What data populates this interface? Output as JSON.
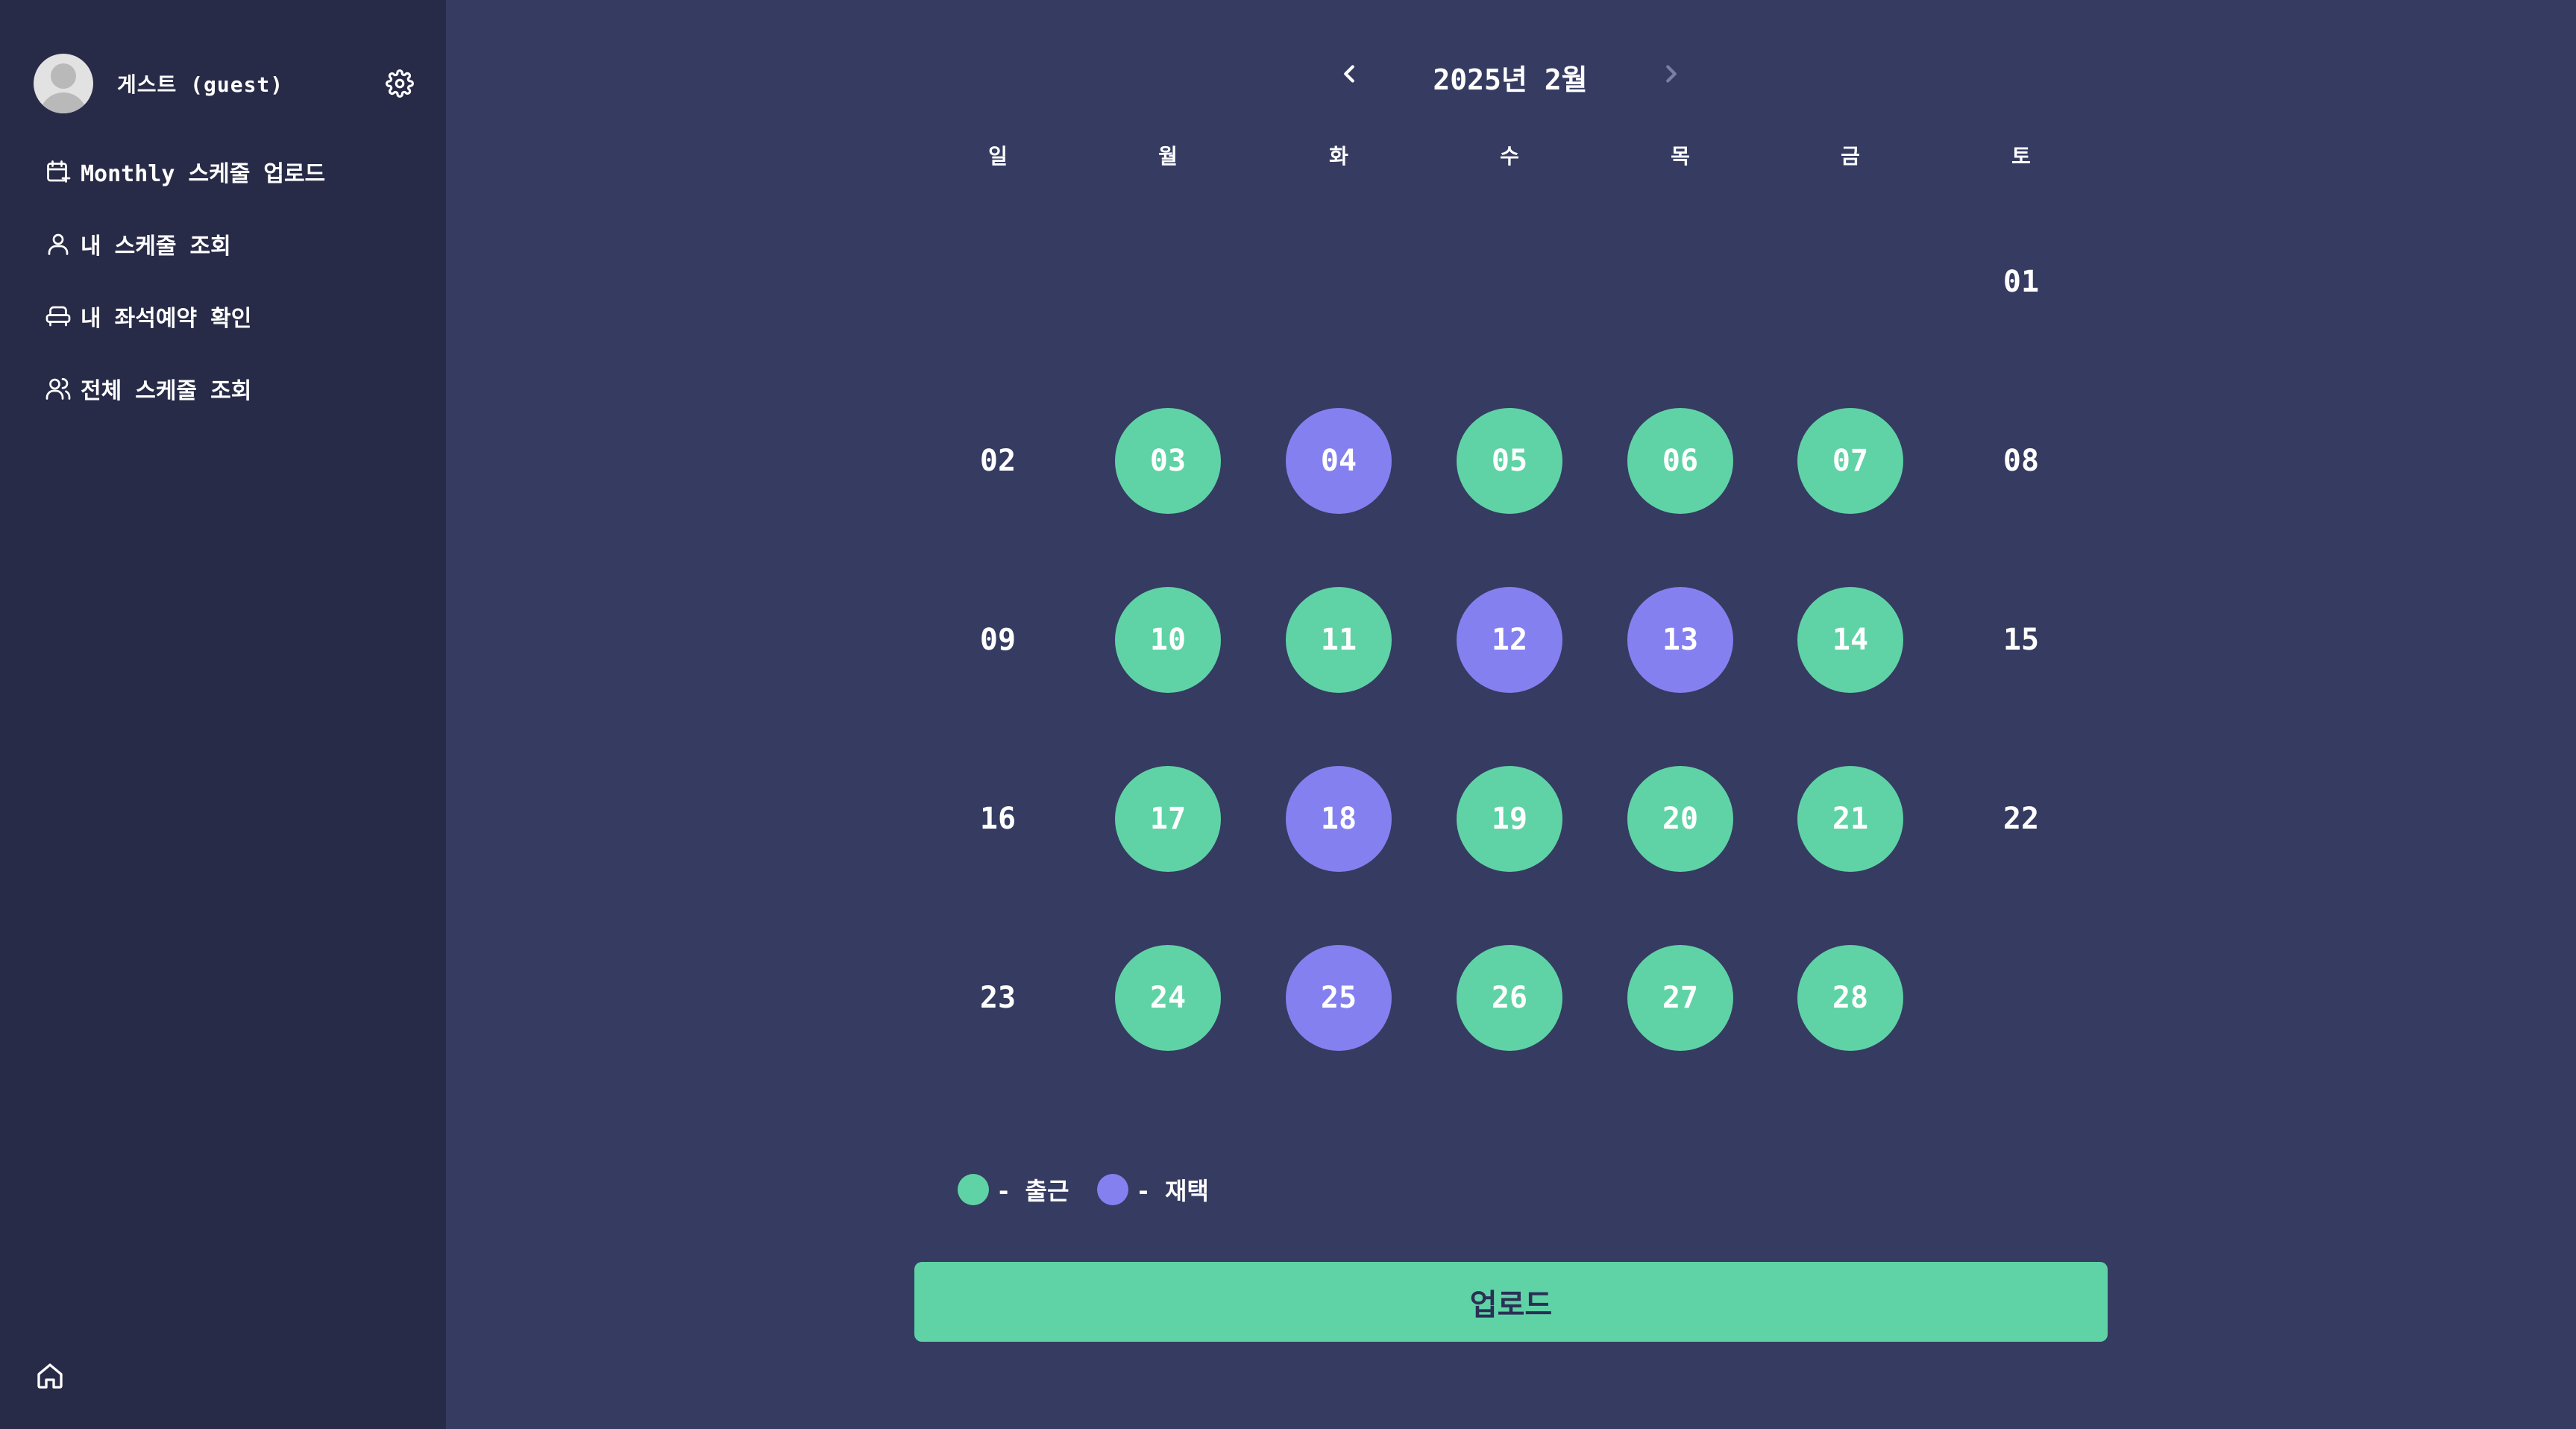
{
  "colors": {
    "background": "#363b61",
    "sidebar": "#282b47",
    "office": "#5fd3a6",
    "remote": "#8580f0",
    "text": "#ffffff"
  },
  "profile": {
    "name": "게스트 (guest)",
    "avatar_icon": "user-avatar-icon",
    "settings_icon": "gear-icon"
  },
  "sidebar": {
    "items": [
      {
        "label": "Monthly 스케줄 업로드",
        "icon": "calendar-plus-icon"
      },
      {
        "label": "내 스케줄 조회",
        "icon": "user-icon"
      },
      {
        "label": "내 좌석예약 확인",
        "icon": "seat-icon"
      },
      {
        "label": "전체 스케줄 조회",
        "icon": "users-icon"
      }
    ],
    "home_icon": "home-icon"
  },
  "calendar": {
    "title": "2025년 2월",
    "weekdays": [
      "일",
      "월",
      "화",
      "수",
      "목",
      "금",
      "토"
    ],
    "days": [
      {
        "label": "01",
        "status": "none"
      },
      {
        "label": "02",
        "status": "none"
      },
      {
        "label": "03",
        "status": "office"
      },
      {
        "label": "04",
        "status": "remote"
      },
      {
        "label": "05",
        "status": "office"
      },
      {
        "label": "06",
        "status": "office"
      },
      {
        "label": "07",
        "status": "office"
      },
      {
        "label": "08",
        "status": "none"
      },
      {
        "label": "09",
        "status": "none"
      },
      {
        "label": "10",
        "status": "office"
      },
      {
        "label": "11",
        "status": "office"
      },
      {
        "label": "12",
        "status": "remote"
      },
      {
        "label": "13",
        "status": "remote"
      },
      {
        "label": "14",
        "status": "office"
      },
      {
        "label": "15",
        "status": "none"
      },
      {
        "label": "16",
        "status": "none"
      },
      {
        "label": "17",
        "status": "office"
      },
      {
        "label": "18",
        "status": "remote"
      },
      {
        "label": "19",
        "status": "office"
      },
      {
        "label": "20",
        "status": "office"
      },
      {
        "label": "21",
        "status": "office"
      },
      {
        "label": "22",
        "status": "none"
      },
      {
        "label": "23",
        "status": "none"
      },
      {
        "label": "24",
        "status": "office"
      },
      {
        "label": "25",
        "status": "remote"
      },
      {
        "label": "26",
        "status": "office"
      },
      {
        "label": "27",
        "status": "office"
      },
      {
        "label": "28",
        "status": "office"
      }
    ]
  },
  "legend": {
    "office": "- 출근",
    "remote": "- 재택"
  },
  "upload_button": "업로드"
}
